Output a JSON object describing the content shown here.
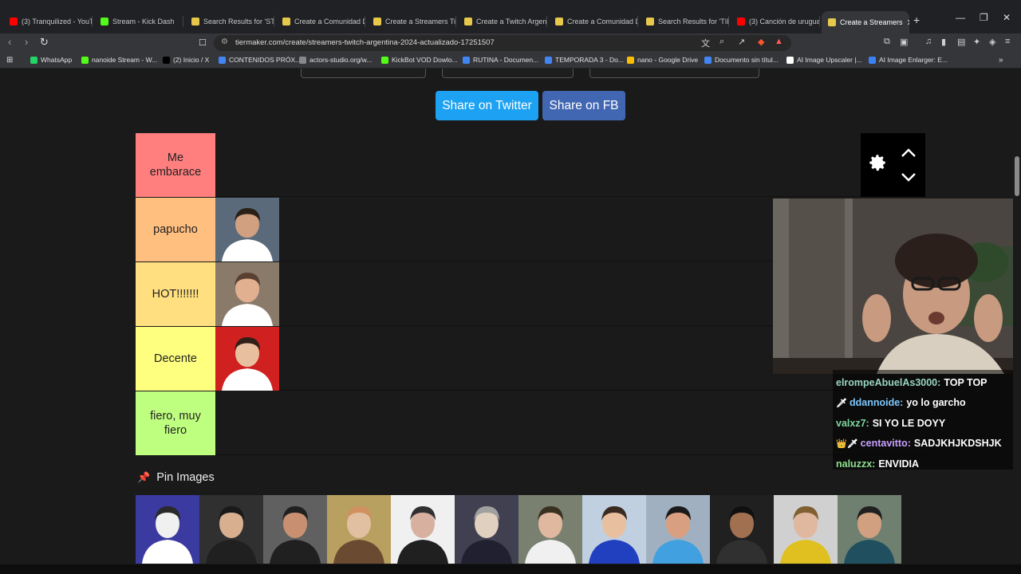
{
  "browser": {
    "tabs": [
      {
        "title": "(3) Tranquilized - YouTu",
        "icon": "youtube-icon",
        "color": "#ff0000"
      },
      {
        "title": "Stream - Kick Dash",
        "icon": "kick-icon",
        "color": "#53fc18"
      },
      {
        "title": "Search Results for 'STR",
        "icon": "tiermaker-icon",
        "color": "#e8c84a"
      },
      {
        "title": "Create a Comunidad D",
        "icon": "tiermaker-icon",
        "color": "#e8c84a"
      },
      {
        "title": "Create a Streamers Tie",
        "icon": "tiermaker-icon",
        "color": "#e8c84a"
      },
      {
        "title": "Create a Twitch Argent",
        "icon": "tiermaker-icon",
        "color": "#e8c84a"
      },
      {
        "title": "Create a Comunidad D",
        "icon": "tiermaker-icon",
        "color": "#e8c84a"
      },
      {
        "title": "Search Results for 'TIE",
        "icon": "tiermaker-icon",
        "color": "#e8c84a"
      },
      {
        "title": "(3) Canción de urugua",
        "icon": "youtube-icon",
        "color": "#ff0000"
      },
      {
        "title": "Create a Streamers",
        "icon": "tiermaker-icon",
        "color": "#e8c84a",
        "active": true
      }
    ],
    "url": "tiermaker.com/create/streamers-twitch-argentina-2024-actualizado-17251507",
    "bookmarks": [
      {
        "label": "WhatsApp",
        "color": "#25d366"
      },
      {
        "label": "nanoide Stream - W...",
        "color": "#53fc18"
      },
      {
        "label": "(2) Inicio / X",
        "color": "#000000"
      },
      {
        "label": "CONTENIDOS PRÓX...",
        "color": "#4285f4"
      },
      {
        "label": "actors-studio.org/w...",
        "color": "#888888"
      },
      {
        "label": "KickBot VOD Dowlo...",
        "color": "#53fc18"
      },
      {
        "label": "RUTINA - Documen...",
        "color": "#4285f4"
      },
      {
        "label": "TEMPORADA 3 - Do...",
        "color": "#4285f4"
      },
      {
        "label": "nano - Google Drive",
        "color": "#fbbc04"
      },
      {
        "label": "Documento sin títul...",
        "color": "#4285f4"
      },
      {
        "label": "AI Image Upscaler |...",
        "color": "#ffffff"
      },
      {
        "label": "AI Image Enlarger: E...",
        "color": "#3b82f6"
      }
    ]
  },
  "share": {
    "twitter_label": "Share on Twitter",
    "fb_label": "Share on FB",
    "twitter_color": "#1da1f2",
    "fb_color": "#4267b2"
  },
  "tiers": [
    {
      "label": "Me embarace",
      "color": "#ff7f7f",
      "items": 0
    },
    {
      "label": "papucho",
      "color": "#ffbf7f",
      "items": 1
    },
    {
      "label": "HOT!!!!!!!",
      "color": "#ffdf7f",
      "items": 1
    },
    {
      "label": "Decente",
      "color": "#ffff7f",
      "items": 1
    },
    {
      "label": "fiero, muy fiero",
      "color": "#bfff7f",
      "items": 0
    }
  ],
  "pin_images_label": "Pin Images",
  "pool_count": 12,
  "chat": [
    {
      "user": "elrompeAbuelAs3000:",
      "msg": "TOP TOP",
      "user_color": "#9ad6c0",
      "badges": ""
    },
    {
      "user": "ddannoide:",
      "msg": "yo lo garcho",
      "user_color": "#7ec8ff",
      "badges": "🗡"
    },
    {
      "user": "valxz7:",
      "msg": "SI YO LE DOYY",
      "user_color": "#7fd6a0",
      "badges": ""
    },
    {
      "user": "centavitto:",
      "msg": "SADJKHJKDSHJK",
      "user_color": "#c9a0ff",
      "badges": "👑🗡"
    },
    {
      "user": "naluzzx:",
      "msg": "ENVIDIA",
      "user_color": "#8fe08f",
      "badges": ""
    }
  ]
}
